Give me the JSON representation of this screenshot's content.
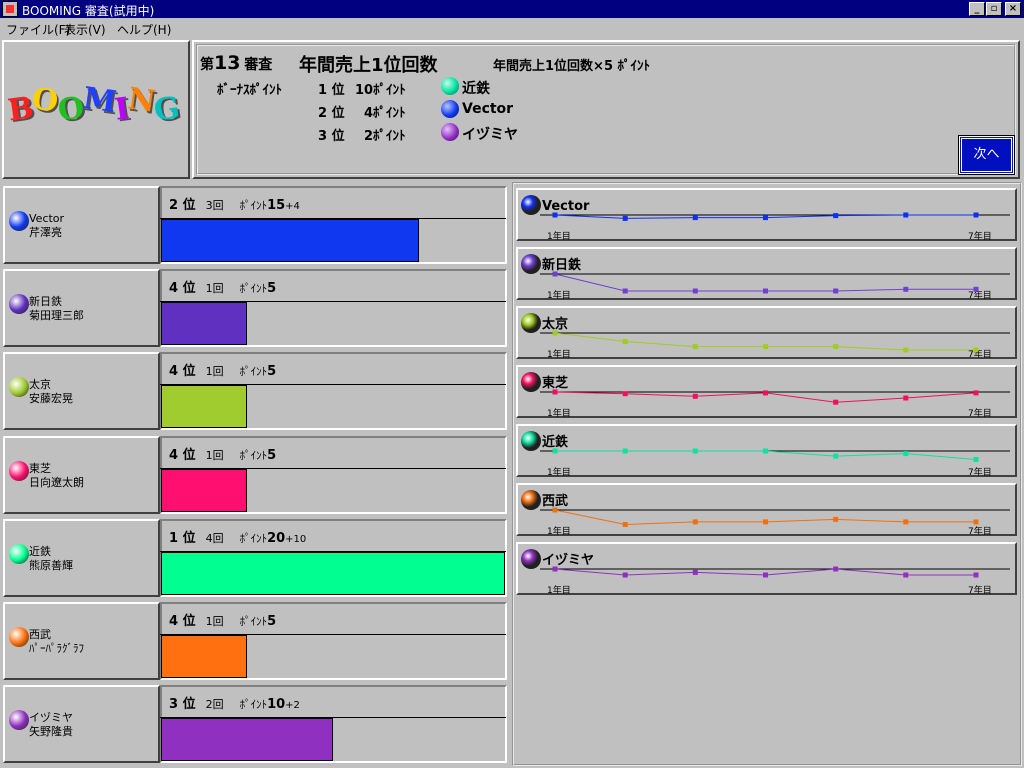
{
  "window": {
    "title": "BOOMING 審査(試用中)",
    "minimize": "_",
    "maximize": "▫",
    "close": "×"
  },
  "menu": [
    "ファイル(F)",
    "表示(V)",
    "ヘルプ(H)"
  ],
  "logo": {
    "text": "BOOMING",
    "colors": [
      "#ff2020",
      "#ffd000",
      "#20c020",
      "#2040ff",
      "#c000ff",
      "#ff8000",
      "#00c0c0"
    ]
  },
  "header": {
    "round_prefix": "第",
    "round_number": "13",
    "round_suffix": "審査",
    "title": "年間売上1位回数",
    "formula": "年間売上1位回数×5 ﾎﾟｲﾝﾄ",
    "bonus_label": "ﾎﾞｰﾅｽﾎﾟｲﾝﾄ",
    "bonus": [
      {
        "rank": "1 位",
        "points": "10ﾎﾟｲﾝﾄ",
        "company": "近鉄",
        "color": "#00e0a0"
      },
      {
        "rank": "2 位",
        "points": "4ﾎﾟｲﾝﾄ",
        "company": "Vector",
        "color": "#1038f0"
      },
      {
        "rank": "3 位",
        "points": "2ﾎﾟｲﾝﾄ",
        "company": "イヅミヤ",
        "color": "#9030c0"
      }
    ],
    "next_label": "次へ"
  },
  "competitors": [
    {
      "company": "Vector",
      "person": "芹澤亮",
      "color": "#1038f0",
      "rank": "2 位",
      "count": "3回",
      "points_label": "ﾎﾟｲﾝﾄ",
      "points": "15",
      "bonus": "+4",
      "bar_fraction": 0.75
    },
    {
      "company": "新日鉄",
      "person": "菊田理三郎",
      "color": "#6030c0",
      "rank": "4 位",
      "count": "1回",
      "points_label": "ﾎﾟｲﾝﾄ",
      "points": "5",
      "bonus": "",
      "bar_fraction": 0.25
    },
    {
      "company": "太京",
      "person": "安藤宏晃",
      "color": "#a0cc30",
      "rank": "4 位",
      "count": "1回",
      "points_label": "ﾎﾟｲﾝﾄ",
      "points": "5",
      "bonus": "",
      "bar_fraction": 0.25
    },
    {
      "company": "東芝",
      "person": "日向遼太朗",
      "color": "#ff1070",
      "rank": "4 位",
      "count": "1回",
      "points_label": "ﾎﾟｲﾝﾄ",
      "points": "5",
      "bonus": "",
      "bar_fraction": 0.25
    },
    {
      "company": "近鉄",
      "person": "熊原善輝",
      "color": "#00ff90",
      "rank": "1 位",
      "count": "4回",
      "points_label": "ﾎﾟｲﾝﾄ",
      "points": "20",
      "bonus": "+10",
      "bar_fraction": 1.0
    },
    {
      "company": "西武",
      "person": "ﾊﾟｰﾊﾟﾗｸﾞﾗﾌ",
      "color": "#ff7010",
      "rank": "4 位",
      "count": "1回",
      "points_label": "ﾎﾟｲﾝﾄ",
      "points": "5",
      "bonus": "",
      "bar_fraction": 0.25
    },
    {
      "company": "イヅミヤ",
      "person": "矢野隆貴",
      "color": "#9030c0",
      "rank": "3 位",
      "count": "2回",
      "points_label": "ﾎﾟｲﾝﾄ",
      "points": "10",
      "bonus": "+2",
      "bar_fraction": 0.5
    }
  ],
  "chart_data": [
    {
      "type": "line",
      "title": "Vector",
      "color": "#1030f0",
      "x_start_label": "1年目",
      "x_end_label": "7年目",
      "x": [
        1,
        2,
        3,
        4,
        5,
        6,
        7
      ],
      "values": [
        1,
        2.2,
        1.9,
        1.9,
        1.2,
        1,
        1
      ],
      "ylim": [
        1,
        7
      ]
    },
    {
      "type": "line",
      "title": "新日鉄",
      "color": "#7040d0",
      "x_start_label": "1年目",
      "x_end_label": "7年目",
      "x": [
        1,
        2,
        3,
        4,
        5,
        6,
        7
      ],
      "values": [
        1,
        4,
        4,
        4,
        4,
        3.7,
        3.7
      ],
      "ylim": [
        1,
        4
      ]
    },
    {
      "type": "line",
      "title": "太京",
      "color": "#a0cc20",
      "x_start_label": "1年目",
      "x_end_label": "7年目",
      "x": [
        1,
        2,
        3,
        4,
        5,
        6,
        7
      ],
      "values": [
        1,
        2,
        2.6,
        2.6,
        2.6,
        3,
        3
      ],
      "ylim": [
        1,
        3
      ]
    },
    {
      "type": "line",
      "title": "東芝",
      "color": "#f01060",
      "x_start_label": "1年目",
      "x_end_label": "7年目",
      "x": [
        1,
        2,
        3,
        4,
        5,
        6,
        7
      ],
      "values": [
        1,
        1.2,
        1.5,
        1.1,
        2.2,
        1.7,
        1.1
      ],
      "ylim": [
        1,
        3
      ]
    },
    {
      "type": "line",
      "title": "近鉄",
      "color": "#10e0a0",
      "x_start_label": "1年目",
      "x_end_label": "7年目",
      "x": [
        1,
        2,
        3,
        4,
        5,
        6,
        7
      ],
      "values": [
        1,
        1,
        1,
        1,
        1.6,
        1.3,
        2
      ],
      "ylim": [
        1,
        3
      ]
    },
    {
      "type": "line",
      "title": "西武",
      "color": "#f07010",
      "x_start_label": "1年目",
      "x_end_label": "7年目",
      "x": [
        1,
        2,
        3,
        4,
        5,
        6,
        7
      ],
      "values": [
        1,
        2.7,
        2.4,
        2.4,
        2.1,
        2.4,
        2.4
      ],
      "ylim": [
        1,
        3
      ]
    },
    {
      "type": "line",
      "title": "イヅミヤ",
      "color": "#9030c0",
      "x_start_label": "1年目",
      "x_end_label": "7年目",
      "x": [
        1,
        2,
        3,
        4,
        5,
        6,
        7
      ],
      "values": [
        1,
        1.7,
        1.4,
        1.7,
        1,
        1.7,
        1.7
      ],
      "ylim": [
        1,
        3
      ]
    }
  ]
}
